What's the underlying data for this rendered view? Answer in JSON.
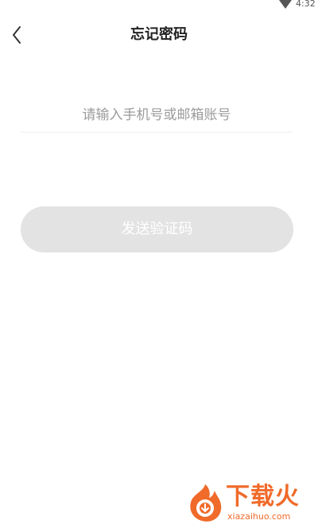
{
  "status_bar": {
    "time": "4:32",
    "wifi_icon": "wifi-icon"
  },
  "header": {
    "title": "忘记密码",
    "back_icon": "chevron-left-icon"
  },
  "form": {
    "account_placeholder": "请输入手机号或邮箱账号",
    "account_value": ""
  },
  "send_code_button": {
    "label": "发送验证码"
  },
  "watermark": {
    "brand": "下载火",
    "url": "xiazaihuo.com",
    "logo_icon": "flame-logo-icon",
    "color": "#f06a2a"
  },
  "colors": {
    "button_disabled": "#e3e3e3",
    "title": "#222222",
    "placeholder": "#9b9b9b"
  }
}
